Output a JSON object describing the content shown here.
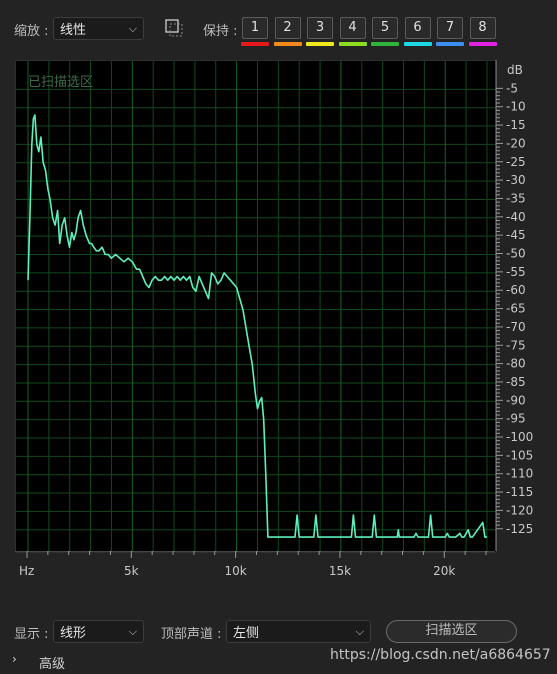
{
  "toolbar": {
    "zoom_label": "缩放 :",
    "zoom_value": "线性",
    "hold_label": "保持 :",
    "hold_buttons": [
      "1",
      "2",
      "3",
      "4",
      "5",
      "6",
      "7",
      "8"
    ],
    "hold_colors": [
      "#e8191a",
      "#f58a1a",
      "#f0e81c",
      "#8ddc1e",
      "#2fb53b",
      "#1bd9e6",
      "#3b8ff0",
      "#e022e0"
    ]
  },
  "plot": {
    "overlay_text": "已扫描选区",
    "trace_color": "#5ff0c0",
    "grid_color": "#0f4a1c",
    "db_unit": "dB",
    "db_labels": [
      "-5",
      "-10",
      "-15",
      "-20",
      "-25",
      "-30",
      "-35",
      "-40",
      "-45",
      "-50",
      "-55",
      "-60",
      "-65",
      "-70",
      "-75",
      "-80",
      "-85",
      "-90",
      "-95",
      "-100",
      "-105",
      "-110",
      "-115",
      "-120",
      "-125"
    ],
    "hz_labels": [
      "Hz",
      "5k",
      "10k",
      "15k",
      "20k"
    ]
  },
  "chart_data": {
    "type": "line",
    "xlabel": "Hz",
    "ylabel": "dB",
    "xlim": [
      0,
      22050
    ],
    "ylim": [
      -130,
      0
    ],
    "grid": true,
    "series": [
      {
        "x": [
          0,
          100,
          180,
          260,
          330,
          420,
          520,
          620,
          730,
          840,
          950,
          1060,
          1180,
          1300,
          1420,
          1520,
          1640,
          1760,
          1880,
          1990,
          2100,
          2200,
          2300,
          2400,
          2520,
          2650,
          2800,
          2950,
          3050,
          3150,
          3280,
          3400,
          3550,
          3700,
          3850,
          4000,
          4200,
          4400,
          4600,
          4800,
          5000,
          5200,
          5350,
          5500,
          5650,
          5800,
          5950,
          6100,
          6250,
          6400,
          6550,
          6700,
          6850,
          7000,
          7150,
          7300,
          7450,
          7600,
          7750,
          7900,
          8050,
          8200,
          8350,
          8500,
          8650,
          8800,
          8950,
          9100,
          9250,
          9400,
          9550,
          9700,
          9850,
          10000,
          10150,
          10300,
          10450,
          10600,
          10750,
          10900,
          11000,
          11100,
          11200,
          11300,
          11400,
          11500,
          11700,
          11900,
          12100,
          12300,
          12500,
          12800,
          12900,
          13000,
          13500,
          13700,
          13800,
          13900,
          14000,
          15000,
          15500,
          15600,
          15700,
          15800,
          16500,
          16600,
          16700,
          17500,
          17700,
          17750,
          17800,
          18500,
          18600,
          18700,
          19200,
          19300,
          19400,
          19500,
          20000,
          20100,
          20200,
          20500,
          20700,
          20800,
          20900,
          21100,
          21200,
          21300,
          21800,
          21900,
          22000
        ],
        "y": [
          -57,
          -38,
          -20,
          -13,
          -12,
          -20,
          -22,
          -18,
          -25,
          -27,
          -32,
          -35,
          -40,
          -42,
          -38,
          -47,
          -42,
          -40,
          -45,
          -48,
          -44,
          -46,
          -44,
          -40,
          -38,
          -42,
          -45,
          -47,
          -47,
          -48,
          -49,
          -49,
          -48,
          -50,
          -50,
          -51,
          -50,
          -51,
          -52,
          -51,
          -52,
          -54,
          -54,
          -56,
          -58,
          -59,
          -57,
          -56,
          -57,
          -57,
          -56,
          -57,
          -56,
          -57,
          -56,
          -57,
          -56,
          -57,
          -56,
          -59,
          -60,
          -56,
          -58,
          -60,
          -62,
          -55,
          -56,
          -58,
          -57,
          -55,
          -56,
          -57,
          -58,
          -59,
          -62,
          -65,
          -70,
          -75,
          -80,
          -88,
          -92,
          -90,
          -89,
          -95,
          -110,
          -127,
          -127,
          -127,
          -127,
          -127,
          -127,
          -127,
          -121,
          -127,
          -127,
          -127,
          -121,
          -127,
          -127,
          -127,
          -127,
          -121,
          -127,
          -127,
          -127,
          -121,
          -127,
          -127,
          -127,
          -125,
          -127,
          -127,
          -126,
          -127,
          -127,
          -121,
          -127,
          -127,
          -127,
          -126,
          -127,
          -127,
          -126,
          -127,
          -127,
          -125,
          -127,
          -127,
          -123,
          -127,
          -127
        ],
        "color": "#5ff0c0"
      }
    ]
  },
  "bottom": {
    "display_label": "显示 :",
    "display_value": "线形",
    "channel_label": "顶部声道 :",
    "channel_value": "左侧",
    "scan_button": "扫描选区",
    "advanced_label": "高级",
    "watermark": "https://blog.csdn.net/a6864657"
  }
}
